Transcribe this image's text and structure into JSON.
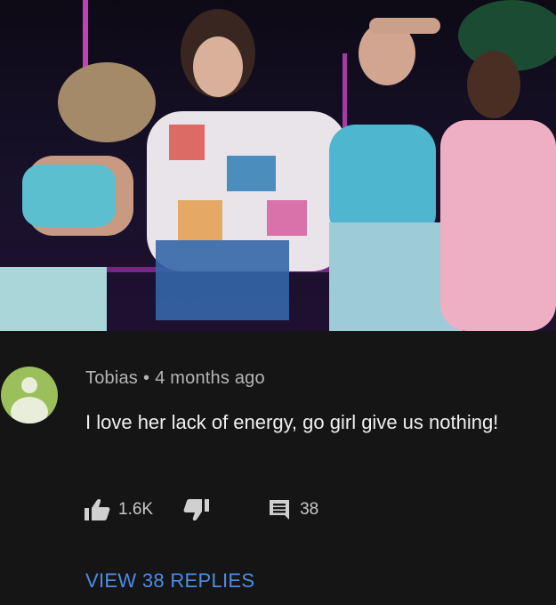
{
  "photo": {
    "icon": "stage-performance-photo"
  },
  "comment": {
    "author": "Tobias",
    "separator": "•",
    "time_ago": "4 months ago",
    "text": "I love her lack of energy, go girl give us nothing!",
    "likes": "1.6K",
    "reply_count": "38",
    "view_replies_label": "VIEW 38 REPLIES",
    "icons": {
      "avatar": "default-avatar-icon",
      "like": "thumbs-up-icon",
      "dislike": "thumbs-down-icon",
      "replies": "comment-icon"
    }
  },
  "colors": {
    "background": "#151515",
    "avatar_bg": "#9bbf5a",
    "meta_text": "#b5b5b5",
    "body_text": "#efefef",
    "link": "#4a8de8"
  }
}
